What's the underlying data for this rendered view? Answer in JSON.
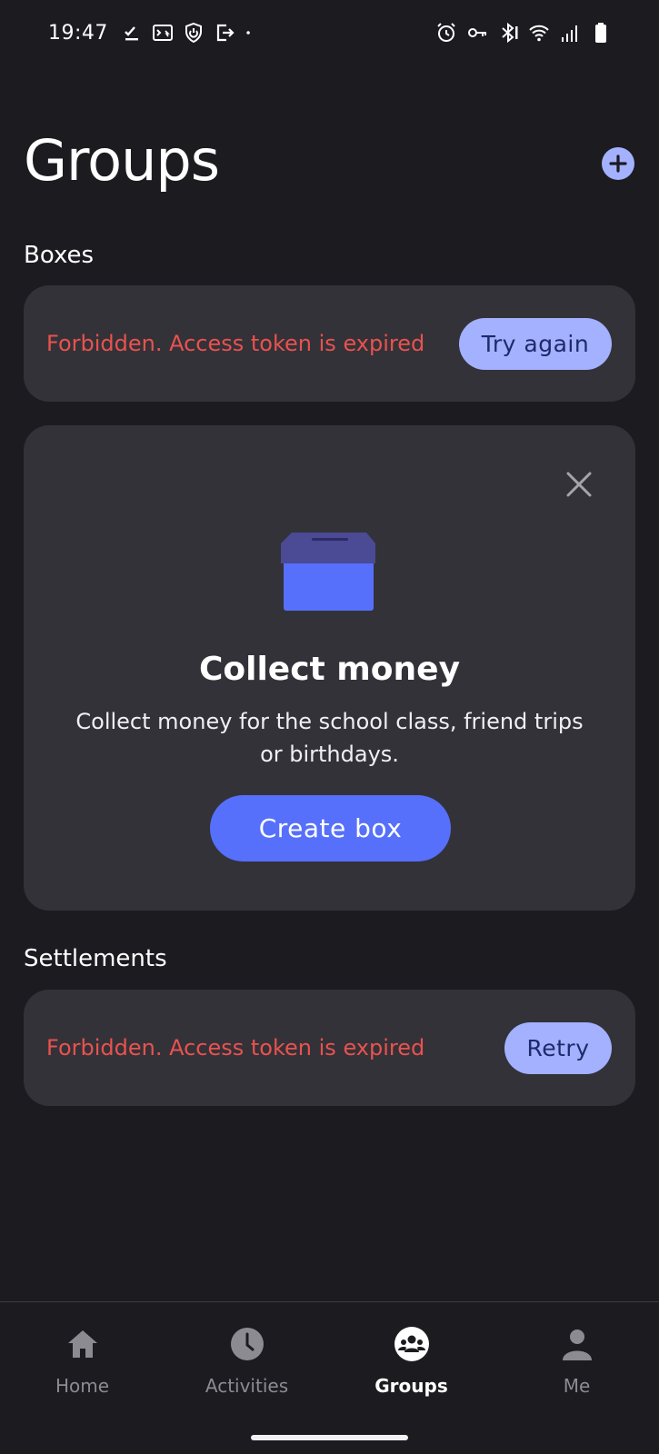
{
  "status_bar": {
    "time": "19:47",
    "left_icons": [
      "download-done-icon",
      "terminal-icon",
      "shield-icon",
      "exit-icon",
      "dot-icon"
    ],
    "right_icons": [
      "alarm-icon",
      "key-icon",
      "bluetooth-icon",
      "wifi-icon",
      "signal-icon",
      "battery-icon"
    ]
  },
  "header": {
    "title": "Groups",
    "add_icon": "plus-circle-icon"
  },
  "boxes": {
    "section_title": "Boxes",
    "error_message": "Forbidden. Access token is expired",
    "retry_label": "Try again"
  },
  "promo": {
    "close_icon": "close-icon",
    "illustration": "money-box-icon",
    "title": "Collect money",
    "description": "Collect money for the school class, friend trips or birthdays.",
    "button_label": "Create box"
  },
  "settlements": {
    "section_title": "Settlements",
    "error_message": "Forbidden. Access token is expired",
    "retry_label": "Retry"
  },
  "bottom_nav": {
    "items": [
      {
        "label": "Home",
        "icon": "home-icon",
        "active": false
      },
      {
        "label": "Activities",
        "icon": "clock-icon",
        "active": false
      },
      {
        "label": "Groups",
        "icon": "groups-icon",
        "active": true
      },
      {
        "label": "Me",
        "icon": "person-icon",
        "active": false
      }
    ]
  },
  "colors": {
    "background": "#1c1b20",
    "card": "#333238",
    "accent": "#5670fb",
    "accent_light": "#a3b1ff",
    "error": "#e9524f"
  }
}
